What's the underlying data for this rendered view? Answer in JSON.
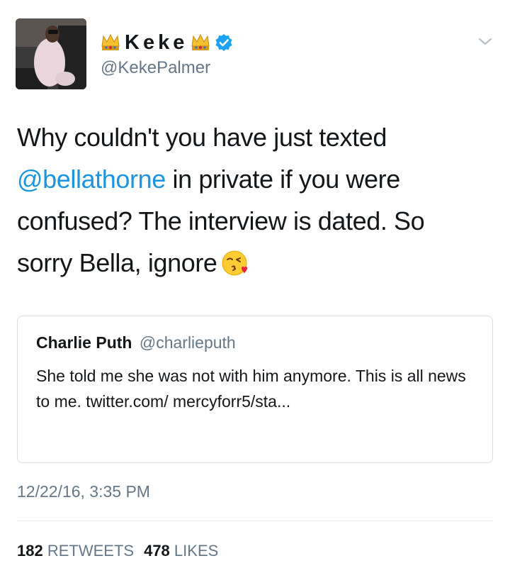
{
  "author": {
    "display_name": "Keke",
    "handle": "@KekePalmer",
    "verified": true,
    "name_decorations": [
      "crown-icon",
      "crown-icon"
    ]
  },
  "tweet": {
    "text_before": "Why couldn't you have just texted ",
    "mention": "@bellathorne",
    "text_after": " in private if you were confused? The interview is dated. So sorry Bella, ignore",
    "emoji": "kissing-face-icon",
    "timestamp": "12/22/16, 3:35 PM"
  },
  "quoted_tweet": {
    "name": "Charlie Puth",
    "handle": "@charlieputh",
    "text": "She told me she was not with him anymore. This is all news to me. twitter.com/ mercyforr5/sta..."
  },
  "stats": {
    "retweets_count": "182",
    "retweets_label": "RETWEETS",
    "likes_count": "478",
    "likes_label": "LIKES"
  },
  "colors": {
    "link": "#1b95e0",
    "secondary_text": "#657786",
    "verified_badge": "#1da1f2",
    "border": "#d8dee3"
  }
}
